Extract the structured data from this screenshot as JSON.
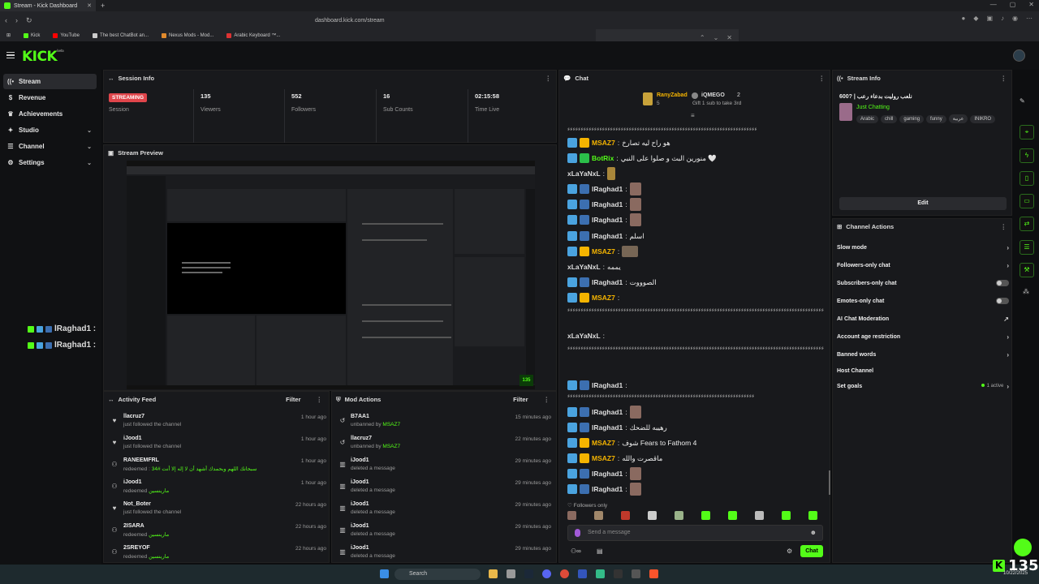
{
  "browser": {
    "tab_title": "Stream - Kick Dashboard",
    "url": "dashboard.kick.com/stream",
    "bookmarks": [
      "Kick",
      "YouTube",
      "The best ChatBot an...",
      "Nexus Mods - Mod...",
      "Arabic Keyboard ™..."
    ]
  },
  "app": {
    "logo": "KICK",
    "logo_sup": "beta"
  },
  "sidebar": {
    "items": [
      {
        "label": "Stream",
        "icon": "broadcast-icon"
      },
      {
        "label": "Revenue",
        "icon": "dollar-icon"
      },
      {
        "label": "Achievements",
        "icon": "trophy-icon"
      },
      {
        "label": "Studio",
        "icon": "studio-icon"
      },
      {
        "label": "Channel",
        "icon": "channel-icon"
      },
      {
        "label": "Settings",
        "icon": "gear-icon"
      }
    ]
  },
  "session": {
    "title": "Session Info",
    "status": "STREAMING",
    "status_label": "Session",
    "stats": [
      {
        "value": "135",
        "label": "Viewers"
      },
      {
        "value": "552",
        "label": "Followers"
      },
      {
        "value": "16",
        "label": "Sub Counts"
      },
      {
        "value": "02:15:58",
        "label": "Time Live"
      }
    ]
  },
  "preview": {
    "title": "Stream Preview",
    "viewer_badge": "135"
  },
  "overlay": {
    "lines": [
      "lRaghad1 :",
      "lRaghad1 :"
    ]
  },
  "activity": {
    "title": "Activity Feed",
    "filter": "Filter",
    "items": [
      {
        "name": "llacruz7",
        "desc": "just followed the channel",
        "time": "1 hour ago",
        "icon": "heart-icon"
      },
      {
        "name": "iJood1",
        "desc": "just followed the channel",
        "time": "1 hour ago",
        "icon": "heart-icon"
      },
      {
        "name": "RANEEMFRL",
        "desc": "redeemed :",
        "reward": "سبحانك اللهم وبحمدك أشهد أن لا إله إلا أنت #34",
        "time": "1 hour ago",
        "icon": "redeem-icon"
      },
      {
        "name": "iJood1",
        "desc": "redeemed",
        "reward": "مارينسين",
        "time": "1 hour ago",
        "icon": "redeem-icon"
      },
      {
        "name": "Not_Boter",
        "desc": "just followed the channel",
        "time": "22 hours ago",
        "icon": "heart-icon"
      },
      {
        "name": "2ISARA",
        "desc": "redeemed",
        "reward": "مارينسين",
        "time": "22 hours ago",
        "icon": "redeem-icon"
      },
      {
        "name": "2SREYOF",
        "desc": "redeemed",
        "reward": "مارينسين",
        "time": "22 hours ago",
        "icon": "redeem-icon"
      }
    ]
  },
  "mod_actions": {
    "title": "Mod Actions",
    "filter": "Filter",
    "items": [
      {
        "name": "B7AA1",
        "desc": "unbanned by",
        "by": "MSAZ7",
        "time": "15 minutes ago",
        "icon": "undo-icon"
      },
      {
        "name": "llacruz7",
        "desc": "unbanned by",
        "by": "MSAZ7",
        "time": "22 minutes ago",
        "icon": "undo-icon"
      },
      {
        "name": "iJood1",
        "desc": "deleted a message",
        "by": "",
        "time": "29 minutes ago",
        "icon": "trash-icon"
      },
      {
        "name": "iJood1",
        "desc": "deleted a message",
        "by": "",
        "time": "29 minutes ago",
        "icon": "trash-icon"
      },
      {
        "name": "iJood1",
        "desc": "deleted a message",
        "by": "",
        "time": "29 minutes ago",
        "icon": "trash-icon"
      },
      {
        "name": "iJood1",
        "desc": "deleted a message",
        "by": "",
        "time": "29 minutes ago",
        "icon": "trash-icon"
      },
      {
        "name": "iJood1",
        "desc": "deleted a message",
        "by": "",
        "time": "29 minutes ago",
        "icon": "trash-icon"
      }
    ]
  },
  "chat": {
    "title": "Chat",
    "pinned": {
      "gifter": "RanyZabad",
      "gift_count": "5",
      "recipient": "iQMEGO",
      "recipient_count": "2",
      "note": "Gift 1 sub to take 3rd"
    },
    "stretch_top": "ءءءءءءءءءءءءءءءءءءءءءءءءءءءءءءءءءءءءءءءءءءءءءءءءءءءءءءءءءءءءءءءءءءءءءءء",
    "messages": [
      {
        "user": "MSAZ7",
        "color": "#f5b400",
        "text": "هو راح ليه تصارخ",
        "badges": [
          "#4aa3df",
          "#f5b400"
        ]
      },
      {
        "user": "BotRix",
        "color": "#53fc18",
        "text": "منورين البث و صلوا على النبي 🤍",
        "badges": [
          "#4aa3df",
          "#2bbf4a"
        ]
      },
      {
        "user": "xLaYaNxL",
        "color": "#dddddd",
        "text": "",
        "badges": [],
        "sticker": true
      },
      {
        "user": "lRaghad1",
        "color": "#dddddd",
        "text": "",
        "badges": [
          "#4aa3df",
          "#3c6fb0"
        ],
        "emote": true
      },
      {
        "user": "lRaghad1",
        "color": "#dddddd",
        "text": "",
        "badges": [
          "#4aa3df",
          "#3c6fb0"
        ],
        "emote": true
      },
      {
        "user": "lRaghad1",
        "color": "#dddddd",
        "text": "",
        "badges": [
          "#4aa3df",
          "#3c6fb0"
        ],
        "emote": true
      },
      {
        "user": "lRaghad1",
        "color": "#dddddd",
        "text": "اسلم",
        "badges": [
          "#4aa3df",
          "#3c6fb0"
        ]
      },
      {
        "user": "MSAZ7",
        "color": "#f5b400",
        "text": "",
        "badges": [
          "#4aa3df",
          "#f5b400"
        ],
        "emote_wide": true
      },
      {
        "user": "xLaYaNxL",
        "color": "#dddddd",
        "text": "يممه",
        "badges": []
      },
      {
        "user": "lRaghad1",
        "color": "#dddddd",
        "text": "الصوووت",
        "badges": [
          "#4aa3df",
          "#3c6fb0"
        ]
      },
      {
        "user": "MSAZ7",
        "color": "#f5b400",
        "text": "",
        "badges": [
          "#4aa3df",
          "#f5b400"
        ]
      }
    ],
    "stretch_mid1": "ءءءءءءءءءءءءءءءءءءءءءءءءءءءءءءءءءءءءءءءءءءءءءءءءءءءءءءءءءءءءءءءءءءءءءءءءءءءءءءءءءءءءءءءءءءءءءءءءءء",
    "stretch_mid2": "ءءءءءءءءءءءءءءءءءءءءءءءءءءءءءءءءءءءءءءءءءء",
    "messages2": [
      {
        "user": "xLaYaNxL",
        "color": "#dddddd",
        "text": "",
        "badges": []
      }
    ],
    "stretch_b1": "ءءءءءءءءءءءءءءءءءءءءءءءءءءءءءءءءءءءءءءءءءءءءءءءءءءءءءءءءءءءءءءءءءءءءءءءءءءءءءءءءءءءءءءءءءءءءءءءءء",
    "stretch_b2": "ءءءءءءءءءءءءءءءءءءءءءءءءءءءءءءءءءءءءءءءءءءءءءءءءءءءءءءءءءءءءءءءءءءءءءءءءءءءءءءءءءءءءءءءءءءءءءءءء",
    "stretch_b3": "ءءءءءءءءء",
    "messages3": [
      {
        "user": "lRaghad1",
        "color": "#dddddd",
        "text": "",
        "badges": [
          "#4aa3df",
          "#3c6fb0"
        ]
      }
    ],
    "stretch_c1": "ءءءءءءءءءءءءءءءءءءءءءءءءءءءءءءءءءءءءءءءءءءءءءءءءءءءءءءءءءءءءءءءءءءءءءء",
    "messages4": [
      {
        "user": "lRaghad1",
        "color": "#dddddd",
        "text": "",
        "badges": [
          "#4aa3df",
          "#3c6fb0"
        ],
        "emote": true
      },
      {
        "user": "lRaghad1",
        "color": "#dddddd",
        "text": "رهيبه للضحك",
        "badges": [
          "#4aa3df",
          "#3c6fb0"
        ]
      },
      {
        "user": "MSAZ7",
        "color": "#f5b400",
        "text": "شوف Fears to Fathom 4",
        "badges": [
          "#4aa3df",
          "#f5b400"
        ]
      },
      {
        "user": "MSAZ7",
        "color": "#f5b400",
        "text": "ماقصرت والله",
        "badges": [
          "#4aa3df",
          "#f5b400"
        ]
      },
      {
        "user": "lRaghad1",
        "color": "#dddddd",
        "text": "",
        "badges": [
          "#4aa3df",
          "#3c6fb0"
        ],
        "emote": true
      },
      {
        "user": "lRaghad1",
        "color": "#dddddd",
        "text": "",
        "badges": [
          "#4aa3df",
          "#3c6fb0"
        ],
        "emote": true
      }
    ],
    "followers_only": "Followers only",
    "placeholder": "Send a message",
    "send": "Chat"
  },
  "stream_info": {
    "title": "Stream Info",
    "stream_title": "600? | نلعب روليت بدعاء رعب",
    "category": "Just Chatting",
    "tags": [
      "Arabic",
      "chill",
      "gaming",
      "funny",
      "عربية",
      "INIKRO"
    ],
    "edit": "Edit"
  },
  "channel_actions": {
    "title": "Channel Actions",
    "items": [
      {
        "label": "Slow mode",
        "control": "chevron"
      },
      {
        "label": "Followers-only chat",
        "control": "chevron"
      },
      {
        "label": "Subscribers-only chat",
        "control": "toggle"
      },
      {
        "label": "Emotes-only chat",
        "control": "toggle"
      },
      {
        "label": "AI Chat Moderation",
        "control": "external"
      },
      {
        "label": "Account age restriction",
        "control": "chevron"
      },
      {
        "label": "Banned words",
        "control": "chevron"
      },
      {
        "label": "Host Channel",
        "control": "none"
      },
      {
        "label": "Set goals",
        "control": "chevron",
        "badge": "1 active"
      }
    ]
  },
  "bottom_badge": {
    "value": "135"
  },
  "taskbar": {
    "search": "Search",
    "time": "10/22/2025"
  },
  "colors": {
    "accent": "#53fc18",
    "streaming": "#e0454b",
    "panel": "#18191c",
    "bg": "#0d0e10"
  }
}
